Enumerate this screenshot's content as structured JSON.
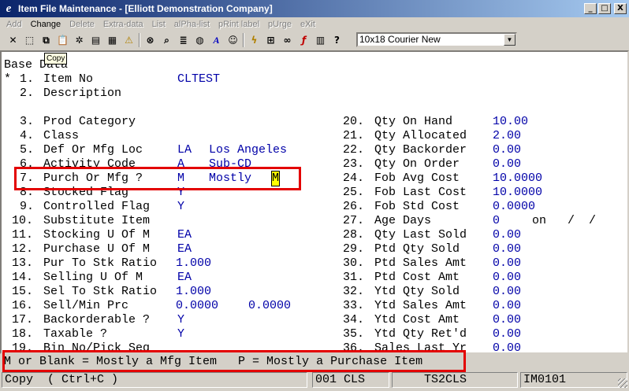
{
  "window": {
    "title": "Item File Maintenance - [Elliott Demonstration Company]",
    "icon": "elliott-e-icon",
    "controls": [
      "_",
      "□",
      "X"
    ]
  },
  "menu": [
    {
      "label": "Add",
      "enabled": false
    },
    {
      "label": "Change",
      "enabled": true
    },
    {
      "label": "Delete",
      "enabled": false
    },
    {
      "label": "Extra-data",
      "enabled": false
    },
    {
      "label": "List",
      "enabled": false
    },
    {
      "label": "alPha-list",
      "enabled": false
    },
    {
      "label": "pRint label",
      "enabled": false
    },
    {
      "label": "pUrge",
      "enabled": false
    },
    {
      "label": "eXit",
      "enabled": false
    }
  ],
  "toolbar": {
    "icons": [
      "cancel-icon",
      "select-icon",
      "copy-icon",
      "paste-icon",
      "settings-icon",
      "page-icon",
      "calendar-icon",
      "warning-icon",
      "binoculars-icon",
      "zoom-icon",
      "notes-icon",
      "color-icon",
      "font-icon",
      "user-icon",
      "lightning-icon",
      "macro-icon",
      "link-icon",
      "function-icon",
      "report-icon",
      "help-icon"
    ],
    "font_select": "10x18 Courier New"
  },
  "tooltip": "Copy",
  "screen": {
    "heading": "Base Data",
    "left_fields": [
      {
        "mark": "*",
        "num": "1.",
        "label": "Item No",
        "value": "CLTEST",
        "extra": ""
      },
      {
        "mark": "",
        "num": "2.",
        "label": "Description",
        "value": "",
        "extra": ""
      },
      {
        "mark": "",
        "num": "3.",
        "label": "Prod Category",
        "value": "",
        "extra": ""
      },
      {
        "mark": "",
        "num": "4.",
        "label": "Class",
        "value": "",
        "extra": ""
      },
      {
        "mark": "",
        "num": "5.",
        "label": "Def Or Mfg Loc",
        "value": "LA",
        "extra": "Los Angeles"
      },
      {
        "mark": "",
        "num": "6.",
        "label": "Activity Code",
        "value": "A",
        "extra": "Sub-CD"
      },
      {
        "mark": "",
        "num": "7.",
        "label": "Purch Or Mfg ?",
        "value": "M",
        "extra": "Mostly",
        "input": "M"
      },
      {
        "mark": "",
        "num": "8.",
        "label": "Stocked Flag",
        "value": "Y",
        "extra": ""
      },
      {
        "mark": "",
        "num": "9.",
        "label": "Controlled Flag",
        "value": "Y",
        "extra": ""
      },
      {
        "mark": "",
        "num": "10.",
        "label": "Substitute Item",
        "value": "",
        "extra": ""
      },
      {
        "mark": "",
        "num": "11.",
        "label": "Stocking U Of M",
        "value": "EA",
        "extra": ""
      },
      {
        "mark": "",
        "num": "12.",
        "label": "Purchase U Of M",
        "value": "EA",
        "extra": ""
      },
      {
        "mark": "",
        "num": "13.",
        "label": "Pur To Stk Ratio",
        "value": "1.000",
        "extra": ""
      },
      {
        "mark": "",
        "num": "14.",
        "label": "Selling U Of M",
        "value": "EA",
        "extra": ""
      },
      {
        "mark": "",
        "num": "15.",
        "label": "Sel To Stk Ratio",
        "value": "1.000",
        "extra": ""
      },
      {
        "mark": "",
        "num": "16.",
        "label": "Sell/Min Prc",
        "value": "0.0000",
        "extra": "0.0000"
      },
      {
        "mark": "",
        "num": "17.",
        "label": "Backorderable ?",
        "value": "Y",
        "extra": ""
      },
      {
        "mark": "",
        "num": "18.",
        "label": "Taxable ?",
        "value": "Y",
        "extra": ""
      },
      {
        "mark": "",
        "num": "19.",
        "label": "Bin No/Pick Seq",
        "value": "",
        "extra": ""
      }
    ],
    "right_fields": [
      {
        "num": "20.",
        "label": "Qty On Hand",
        "value": "10.00"
      },
      {
        "num": "21.",
        "label": "Qty Allocated",
        "value": "2.00"
      },
      {
        "num": "22.",
        "label": "Qty Backorder",
        "value": "0.00"
      },
      {
        "num": "23.",
        "label": "Qty On Order",
        "value": "0.00"
      },
      {
        "num": "24.",
        "label": "Fob Avg Cost",
        "value": "10.0000"
      },
      {
        "num": "25.",
        "label": "Fob Last Cost",
        "value": "10.0000"
      },
      {
        "num": "26.",
        "label": "Fob Std Cost",
        "value": "0.0000"
      },
      {
        "num": "27.",
        "label": "Age Days",
        "value": "0",
        "extra": "on   /  /"
      },
      {
        "num": "28.",
        "label": "Qty Last Sold",
        "value": "0.00"
      },
      {
        "num": "29.",
        "label": "Ptd Qty Sold",
        "value": "0.00"
      },
      {
        "num": "30.",
        "label": "Ptd Sales Amt",
        "value": "0.00"
      },
      {
        "num": "31.",
        "label": "Ptd Cost Amt",
        "value": "0.00"
      },
      {
        "num": "32.",
        "label": "Ytd Qty Sold",
        "value": "0.00"
      },
      {
        "num": "33.",
        "label": "Ytd Sales Amt",
        "value": "0.00"
      },
      {
        "num": "34.",
        "label": "Ytd Cost Amt",
        "value": "0.00"
      },
      {
        "num": "35.",
        "label": "Ytd Qty Ret'd",
        "value": "0.00"
      },
      {
        "num": "36.",
        "label": "Sales Last Yr",
        "value": "0.00"
      }
    ]
  },
  "message": "M or Blank = Mostly a Mfg Item   P = Mostly a Purchase Item",
  "status": {
    "action": "Copy  ( Ctrl+C )",
    "code": "001 CLS",
    "screen": "TS2CLS",
    "module": "IM0101"
  },
  "highlight_color": "#e30000"
}
